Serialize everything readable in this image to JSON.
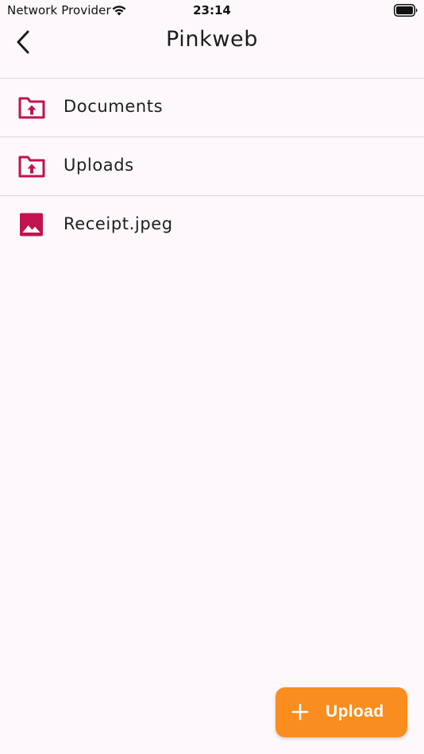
{
  "status_bar": {
    "carrier": "Network Provider",
    "time": "23:14",
    "wifi_icon": "wifi-icon",
    "battery_icon": "battery-icon"
  },
  "nav": {
    "title": "Pinkweb",
    "back_icon": "chevron-left-icon"
  },
  "files": [
    {
      "name": "Documents",
      "icon": "folder-upload-icon"
    },
    {
      "name": "Uploads",
      "icon": "folder-upload-icon"
    },
    {
      "name": "Receipt.jpeg",
      "icon": "image-icon"
    }
  ],
  "fab": {
    "label": "Upload",
    "icon": "plus-icon"
  },
  "colors": {
    "background": "#fdf8fb",
    "icon_accent": "#c0134f",
    "fab": "#f98d1f",
    "divider": "#dcd7da"
  }
}
